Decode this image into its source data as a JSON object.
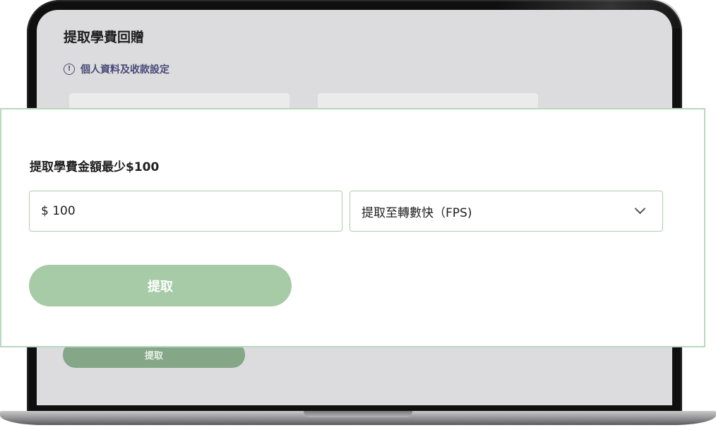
{
  "background_screen": {
    "title": "提取學費回贈",
    "settings_link": "個人資料及收款設定",
    "settings_icon": "info-circle-icon",
    "button_label": "提取"
  },
  "withdraw_panel": {
    "min_amount_label": "提取學費金額最少$100",
    "amount_value": "$ 100",
    "method_selected": "提取至轉數快（FPS)",
    "method_icon": "chevron-down-icon",
    "submit_label": "提取"
  },
  "colors": {
    "accent_green": "#a7cba6",
    "border_green": "#a9cfae",
    "link_purple": "#4a4a78"
  }
}
